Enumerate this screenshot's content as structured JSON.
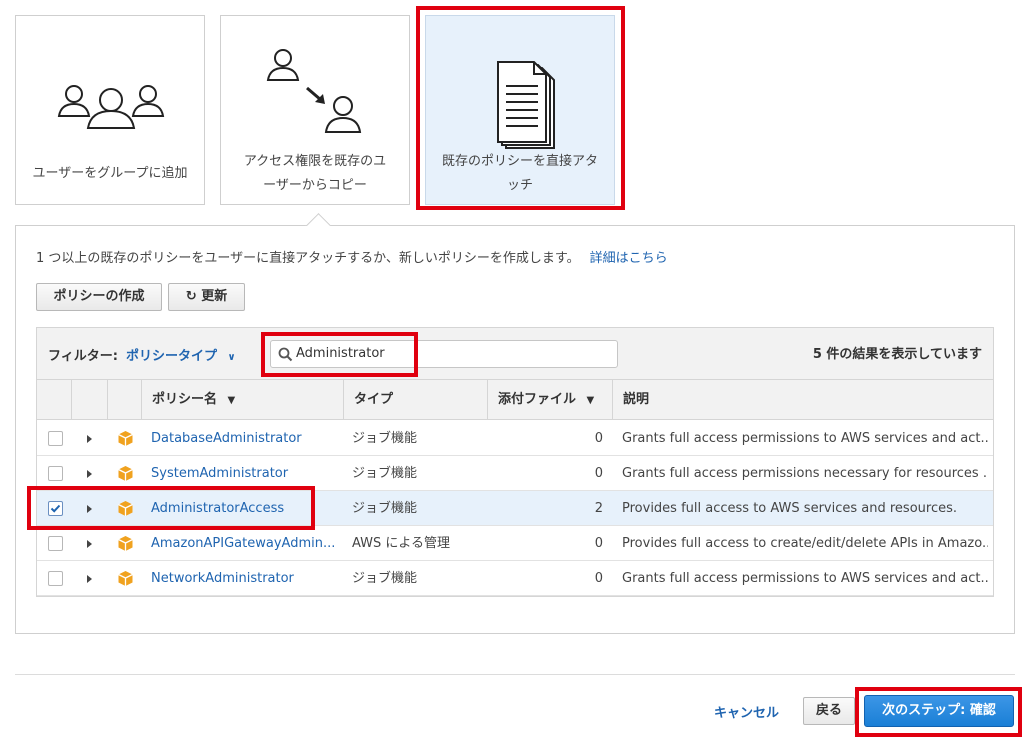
{
  "options": [
    {
      "label_line1": "ユーザーをグループに追加",
      "label_line2": ""
    },
    {
      "label_line1": "アクセス権限を既存のユ",
      "label_line2": "ーザーからコピー"
    },
    {
      "label_line1": "既存のポリシーを直接アタ",
      "label_line2": "ッチ"
    }
  ],
  "description": {
    "text": "1 つ以上の既存のポリシーをユーザーに直接アタッチするか、新しいポリシーを作成します。",
    "link": "詳細はこちら"
  },
  "toolbar": {
    "create_policy": "ポリシーの作成",
    "refresh": "更新"
  },
  "filter": {
    "label": "フィルター:",
    "value": "ポリシータイプ",
    "search_value": "Administrator",
    "result_count": "5 件の結果を表示しています"
  },
  "columns": {
    "name": "ポリシー名",
    "type": "タイプ",
    "attachments": "添付ファイル",
    "description": "説明"
  },
  "rows": [
    {
      "name": "DatabaseAdministrator",
      "type": "ジョブ機能",
      "attachments": "0",
      "description": "Grants full access permissions to AWS services and act...",
      "checked": false
    },
    {
      "name": "SystemAdministrator",
      "type": "ジョブ機能",
      "attachments": "0",
      "description": "Grants full access permissions necessary for resources ...",
      "checked": false
    },
    {
      "name": "AdministratorAccess",
      "type": "ジョブ機能",
      "attachments": "2",
      "description": "Provides full access to AWS services and resources.",
      "checked": true
    },
    {
      "name": "AmazonAPIGatewayAdmin...",
      "type": "AWS による管理",
      "attachments": "0",
      "description": "Provides full access to create/edit/delete APIs in Amazo...",
      "checked": false
    },
    {
      "name": "NetworkAdministrator",
      "type": "ジョブ機能",
      "attachments": "0",
      "description": "Grants full access permissions to AWS services and act...",
      "checked": false
    }
  ],
  "footer": {
    "cancel": "キャンセル",
    "back": "戻る",
    "next": "次のステップ: 確認"
  },
  "colors": {
    "highlight": "#e0000f",
    "link": "#1f64b0",
    "primary": "#1a7fd6",
    "selected_bg": "#e7f1fb",
    "policy_icon": "#f0a21f"
  }
}
